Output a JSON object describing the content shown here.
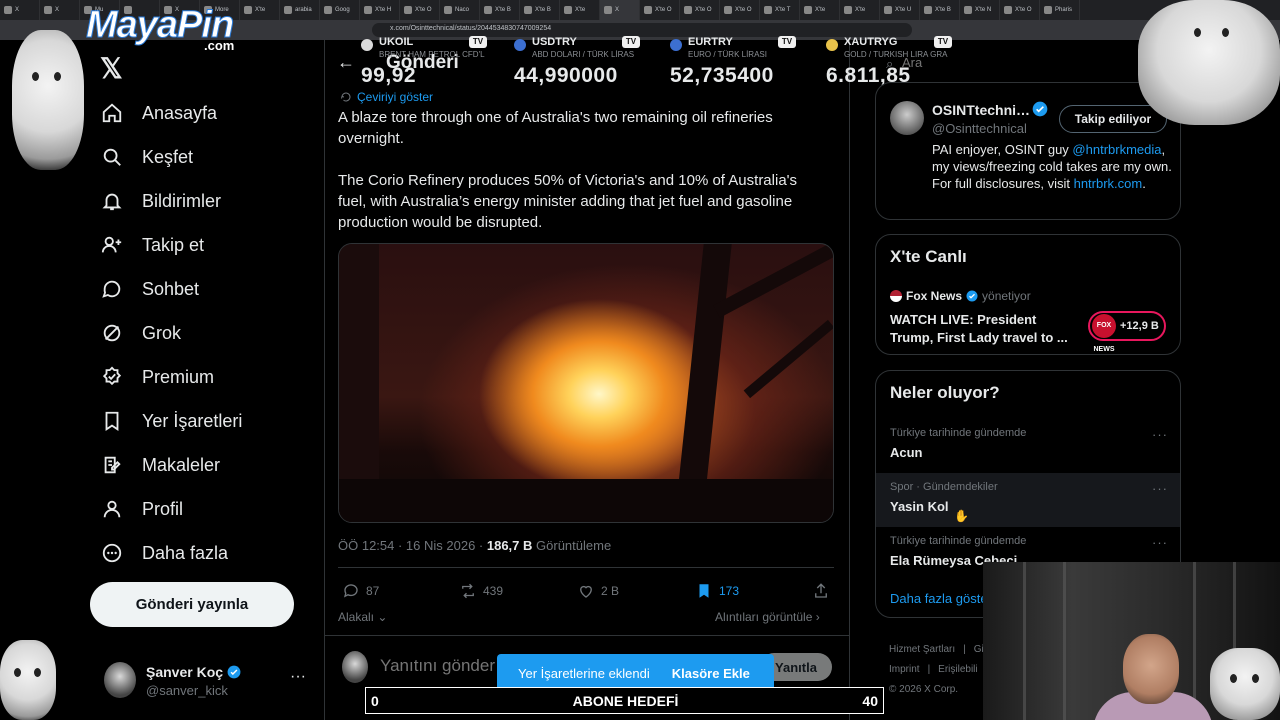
{
  "browser": {
    "tabs": [
      "X",
      "X",
      "Mu",
      "",
      "X",
      "More",
      "X'te",
      "arabia",
      "Goog",
      "X'te H",
      "X'te O",
      "Naco",
      "X'te B",
      "X'te B",
      "X'te",
      "X",
      "X'te O",
      "X'te O",
      "X'te O",
      "X'te T",
      "X'te",
      "X'te",
      "X'te U",
      "X'te B",
      "X'te N",
      "X'te O",
      "Pharis"
    ],
    "url": "x.com/Osinttechnical/status/2044534830747009254"
  },
  "overlay": {
    "watermark": "MayaPin",
    "watermark_sub": ".com",
    "subscriber_goal": {
      "current": "0",
      "label": "ABONE HEDEFİ",
      "target": "40"
    }
  },
  "ticker": [
    {
      "symbol": "UKOIL",
      "sub": "BRENT HAM PETROL CFD'L",
      "value": "99,92",
      "color": "#d9d9d9"
    },
    {
      "symbol": "USDTRY",
      "sub": "ABD DOLARI / TÜRK LİRAS",
      "value": "44,990000",
      "color": "#3c6fd1"
    },
    {
      "symbol": "EURTRY",
      "sub": "EURO / TÜRK LİRASI",
      "value": "52,735400",
      "color": "#3c6fd1"
    },
    {
      "symbol": "XAUTRYG",
      "sub": "GOLD / TURKISH LIRA GRA",
      "value": "6.811,85",
      "color": "#e8c24a"
    }
  ],
  "ticker_badge": "TV",
  "nav": {
    "logo": "𝕏",
    "items": [
      {
        "label": "Anasayfa",
        "icon": "home-icon"
      },
      {
        "label": "Keşfet",
        "icon": "search-icon"
      },
      {
        "label": "Bildirimler",
        "icon": "bell-icon"
      },
      {
        "label": "Takip et",
        "icon": "follow-icon"
      },
      {
        "label": "Sohbet",
        "icon": "chat-icon"
      },
      {
        "label": "Grok",
        "icon": "grok-icon"
      },
      {
        "label": "Premium",
        "icon": "premium-icon"
      },
      {
        "label": "Yer İşaretleri",
        "icon": "bookmark-icon"
      },
      {
        "label": "Makaleler",
        "icon": "articles-icon"
      },
      {
        "label": "Profil",
        "icon": "profile-icon"
      },
      {
        "label": "Daha fazla",
        "icon": "more-icon"
      }
    ],
    "post_button": "Gönderi yayınla",
    "account": {
      "name": "Şanver Koç",
      "handle": "@sanver_kick",
      "more": "···"
    }
  },
  "post": {
    "back": "←",
    "title": "Gönderi",
    "translate": "Çeviriyi göster",
    "paragraphs": [
      "A blaze tore through one of Australia's two remaining oil refineries overnight.",
      "The Corio Refinery produces 50% of Victoria's and 10% of Australia's fuel, with Australia’s energy minister adding that jet fuel and gasoline production would be disrupted."
    ],
    "timestamp": "ÖÖ 12:54 · 16 Nis 2026 · ",
    "views_count": "186,7 B",
    "views_label": " Görüntüleme",
    "replies": "87",
    "reposts": "439",
    "likes": "2 B",
    "bookmarks": "173",
    "related": "Alakalı",
    "quotes": "Alıntıları görüntüle",
    "reply_placeholder": "Yanıtını gönder",
    "reply_button": "Yanıtla"
  },
  "search": {
    "placeholder": "Ara"
  },
  "profile_card": {
    "name": "OSINTtechni…",
    "handle": "@Osinttechnical",
    "follow": "Takip ediliyor",
    "bio_1": "PAI enjoyer, OSINT guy ",
    "bio_link1": "@hntrbrkmedia",
    "bio_2": ", my views/freezing cold takes are my own. For full disclosures, visit ",
    "bio_link2": "hntrbrk.com",
    "bio_3": "."
  },
  "live": {
    "title": "X'te Canlı",
    "source": "Fox News",
    "role": "yönetiyor",
    "description": "WATCH LIVE: President Trump, First Lady travel to ...",
    "badge_logo": "FOX NEWS",
    "listeners": "+12,9 B"
  },
  "trends": {
    "title": "Neler oluyor?",
    "items": [
      {
        "context": "Türkiye tarihinde gündemde",
        "name": "Acun"
      },
      {
        "context": "Spor · Gündemdekiler",
        "name": "Yasin Kol"
      },
      {
        "context": "Türkiye tarihinde gündemde",
        "name": "Ela Rümeysa Cebeci"
      }
    ],
    "more_label": "···",
    "show_more": "Daha fazla göster"
  },
  "footer": {
    "terms": "Hizmet Şartları",
    "privacy": "Gi",
    "imprint": "Imprint",
    "accessibility": "Erişilebili",
    "copyright": "© 2026 X Corp."
  },
  "toast": {
    "message": "Yer İşaretlerine eklendi",
    "action": "Klasöre Ekle"
  },
  "colors": {
    "accent": "#1d9bf0",
    "background": "#000000",
    "muted": "#71767b",
    "live_ring": "#e8175d"
  }
}
